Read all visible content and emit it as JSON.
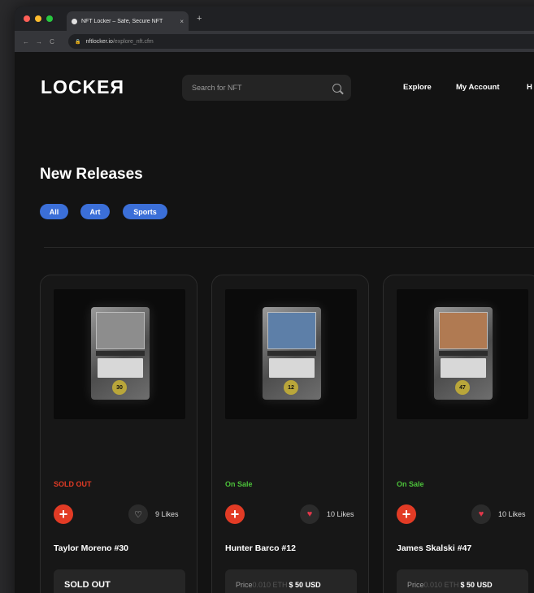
{
  "browser": {
    "tab_title": "NFT Locker – Safe, Secure NFT",
    "tab_close": "×",
    "new_tab": "+",
    "url_host": "nftlocker.io",
    "url_path": "/explore_nft.cfm",
    "back": "←",
    "forward": "→",
    "reload": "C"
  },
  "header": {
    "logo": "LOCKEЯ",
    "search_placeholder": "Search for NFT",
    "nav": [
      "Explore",
      "My Account",
      "H"
    ]
  },
  "main": {
    "heading": "New Releases",
    "filters": [
      "All",
      "Art",
      "Sports"
    ]
  },
  "cards": [
    {
      "number": "30",
      "status": "SOLD OUT",
      "status_color": "#e23b25",
      "likes": "9 Likes",
      "liked": false,
      "name": "Taylor Moreno #30",
      "sold_label": "SOLD OUT",
      "price_label": "",
      "price_eth": "",
      "price_usd": ""
    },
    {
      "number": "12",
      "status": "On Sale",
      "status_color": "#4cc23a",
      "likes": "10 Likes",
      "liked": true,
      "name": "Hunter Barco #12",
      "sold_label": "",
      "price_label": "Price ",
      "price_eth": "0.010 ETH",
      "price_usd": "$ 50 USD"
    },
    {
      "number": "47",
      "status": "On Sale",
      "status_color": "#4cc23a",
      "likes": "10 Likes",
      "liked": true,
      "name": "James Skalski #47",
      "sold_label": "",
      "price_label": "Price ",
      "price_eth": "0.010 ETH",
      "price_usd": "$ 50 USD"
    }
  ],
  "colors": {
    "accent": "#3b6fd8",
    "add_button": "#e23b25",
    "heart_liked": "#e2374a",
    "heart_unliked": "#c8c8c8"
  }
}
